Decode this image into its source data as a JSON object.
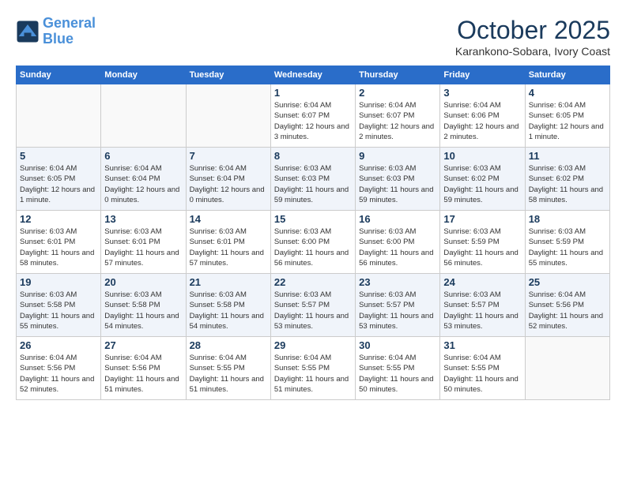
{
  "header": {
    "logo_line1": "General",
    "logo_line2": "Blue",
    "month": "October 2025",
    "location": "Karankono-Sobara, Ivory Coast"
  },
  "weekdays": [
    "Sunday",
    "Monday",
    "Tuesday",
    "Wednesday",
    "Thursday",
    "Friday",
    "Saturday"
  ],
  "weeks": [
    [
      {
        "day": "",
        "info": ""
      },
      {
        "day": "",
        "info": ""
      },
      {
        "day": "",
        "info": ""
      },
      {
        "day": "1",
        "info": "Sunrise: 6:04 AM\nSunset: 6:07 PM\nDaylight: 12 hours and 3 minutes."
      },
      {
        "day": "2",
        "info": "Sunrise: 6:04 AM\nSunset: 6:07 PM\nDaylight: 12 hours and 2 minutes."
      },
      {
        "day": "3",
        "info": "Sunrise: 6:04 AM\nSunset: 6:06 PM\nDaylight: 12 hours and 2 minutes."
      },
      {
        "day": "4",
        "info": "Sunrise: 6:04 AM\nSunset: 6:05 PM\nDaylight: 12 hours and 1 minute."
      }
    ],
    [
      {
        "day": "5",
        "info": "Sunrise: 6:04 AM\nSunset: 6:05 PM\nDaylight: 12 hours and 1 minute."
      },
      {
        "day": "6",
        "info": "Sunrise: 6:04 AM\nSunset: 6:04 PM\nDaylight: 12 hours and 0 minutes."
      },
      {
        "day": "7",
        "info": "Sunrise: 6:04 AM\nSunset: 6:04 PM\nDaylight: 12 hours and 0 minutes."
      },
      {
        "day": "8",
        "info": "Sunrise: 6:03 AM\nSunset: 6:03 PM\nDaylight: 11 hours and 59 minutes."
      },
      {
        "day": "9",
        "info": "Sunrise: 6:03 AM\nSunset: 6:03 PM\nDaylight: 11 hours and 59 minutes."
      },
      {
        "day": "10",
        "info": "Sunrise: 6:03 AM\nSunset: 6:02 PM\nDaylight: 11 hours and 59 minutes."
      },
      {
        "day": "11",
        "info": "Sunrise: 6:03 AM\nSunset: 6:02 PM\nDaylight: 11 hours and 58 minutes."
      }
    ],
    [
      {
        "day": "12",
        "info": "Sunrise: 6:03 AM\nSunset: 6:01 PM\nDaylight: 11 hours and 58 minutes."
      },
      {
        "day": "13",
        "info": "Sunrise: 6:03 AM\nSunset: 6:01 PM\nDaylight: 11 hours and 57 minutes."
      },
      {
        "day": "14",
        "info": "Sunrise: 6:03 AM\nSunset: 6:01 PM\nDaylight: 11 hours and 57 minutes."
      },
      {
        "day": "15",
        "info": "Sunrise: 6:03 AM\nSunset: 6:00 PM\nDaylight: 11 hours and 56 minutes."
      },
      {
        "day": "16",
        "info": "Sunrise: 6:03 AM\nSunset: 6:00 PM\nDaylight: 11 hours and 56 minutes."
      },
      {
        "day": "17",
        "info": "Sunrise: 6:03 AM\nSunset: 5:59 PM\nDaylight: 11 hours and 56 minutes."
      },
      {
        "day": "18",
        "info": "Sunrise: 6:03 AM\nSunset: 5:59 PM\nDaylight: 11 hours and 55 minutes."
      }
    ],
    [
      {
        "day": "19",
        "info": "Sunrise: 6:03 AM\nSunset: 5:58 PM\nDaylight: 11 hours and 55 minutes."
      },
      {
        "day": "20",
        "info": "Sunrise: 6:03 AM\nSunset: 5:58 PM\nDaylight: 11 hours and 54 minutes."
      },
      {
        "day": "21",
        "info": "Sunrise: 6:03 AM\nSunset: 5:58 PM\nDaylight: 11 hours and 54 minutes."
      },
      {
        "day": "22",
        "info": "Sunrise: 6:03 AM\nSunset: 5:57 PM\nDaylight: 11 hours and 53 minutes."
      },
      {
        "day": "23",
        "info": "Sunrise: 6:03 AM\nSunset: 5:57 PM\nDaylight: 11 hours and 53 minutes."
      },
      {
        "day": "24",
        "info": "Sunrise: 6:03 AM\nSunset: 5:57 PM\nDaylight: 11 hours and 53 minutes."
      },
      {
        "day": "25",
        "info": "Sunrise: 6:04 AM\nSunset: 5:56 PM\nDaylight: 11 hours and 52 minutes."
      }
    ],
    [
      {
        "day": "26",
        "info": "Sunrise: 6:04 AM\nSunset: 5:56 PM\nDaylight: 11 hours and 52 minutes."
      },
      {
        "day": "27",
        "info": "Sunrise: 6:04 AM\nSunset: 5:56 PM\nDaylight: 11 hours and 51 minutes."
      },
      {
        "day": "28",
        "info": "Sunrise: 6:04 AM\nSunset: 5:55 PM\nDaylight: 11 hours and 51 minutes."
      },
      {
        "day": "29",
        "info": "Sunrise: 6:04 AM\nSunset: 5:55 PM\nDaylight: 11 hours and 51 minutes."
      },
      {
        "day": "30",
        "info": "Sunrise: 6:04 AM\nSunset: 5:55 PM\nDaylight: 11 hours and 50 minutes."
      },
      {
        "day": "31",
        "info": "Sunrise: 6:04 AM\nSunset: 5:55 PM\nDaylight: 11 hours and 50 minutes."
      },
      {
        "day": "",
        "info": ""
      }
    ]
  ]
}
